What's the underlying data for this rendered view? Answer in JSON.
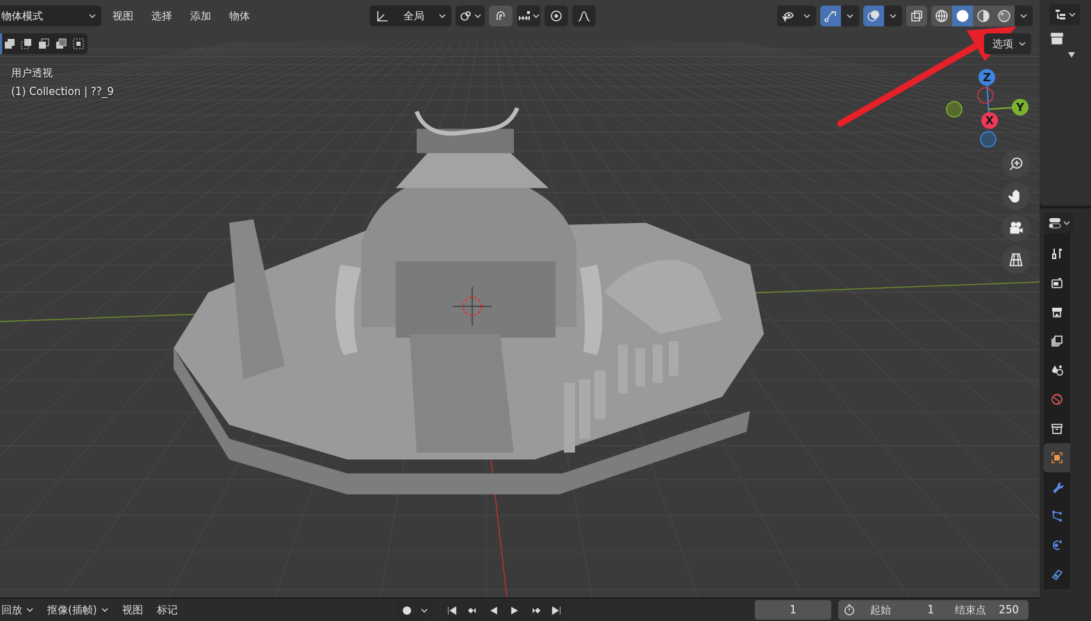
{
  "header": {
    "mode": "物体模式",
    "menus": [
      "视图",
      "选择",
      "添加",
      "物体"
    ],
    "orientation": "全局",
    "toggles": [
      {
        "kind": "pivot",
        "selected": false
      },
      {
        "kind": "snap",
        "selected": true
      },
      {
        "kind": "increment",
        "selected": false
      },
      {
        "kind": "proportional",
        "selected": false
      },
      {
        "kind": "falloff",
        "selected": false
      }
    ],
    "view_toggles": [
      {
        "kind": "visibility",
        "selected": false
      },
      {
        "kind": "gizmo",
        "selected": true
      },
      {
        "kind": "overlay",
        "selected": true
      },
      {
        "kind": "xray",
        "selected": false
      }
    ],
    "shading": [
      {
        "kind": "wireframe",
        "selected": false
      },
      {
        "kind": "solid",
        "selected": true
      },
      {
        "kind": "material",
        "selected": false
      },
      {
        "kind": "rendered",
        "selected": false
      }
    ],
    "options": "选项"
  },
  "select_modes": [
    {
      "kind": "set",
      "selected": true
    },
    {
      "kind": "extend",
      "selected": false
    },
    {
      "kind": "subtract",
      "selected": false
    },
    {
      "kind": "invert",
      "selected": false
    },
    {
      "kind": "intersect",
      "selected": false
    }
  ],
  "viewport": {
    "view_name": "用户透视",
    "object_info": "(1) Collection | ??_9"
  },
  "gizmo": {
    "axes": [
      "Z",
      "Y",
      "X"
    ]
  },
  "nav_buttons": [
    {
      "kind": "zoom"
    },
    {
      "kind": "pan"
    },
    {
      "kind": "camera"
    },
    {
      "kind": "ortho"
    }
  ],
  "properties_tabs": [
    {
      "kind": "tool",
      "selected": false
    },
    {
      "kind": "render",
      "selected": false
    },
    {
      "kind": "output",
      "selected": false
    },
    {
      "kind": "view_layer",
      "selected": false
    },
    {
      "kind": "scene",
      "selected": false
    },
    {
      "kind": "world",
      "selected": false
    },
    {
      "kind": "collection",
      "selected": false
    },
    {
      "kind": "object",
      "selected": true
    },
    {
      "kind": "modifier",
      "selected": false
    },
    {
      "kind": "particles",
      "selected": false
    },
    {
      "kind": "physics",
      "selected": false
    },
    {
      "kind": "constraints",
      "selected": false
    }
  ],
  "timeline": {
    "menus": [
      "回放",
      "抠像(插帧)",
      "视图",
      "标记"
    ],
    "current_frame": "1",
    "start_label": "起始",
    "start": "1",
    "end_label": "结束点",
    "end": "250"
  }
}
